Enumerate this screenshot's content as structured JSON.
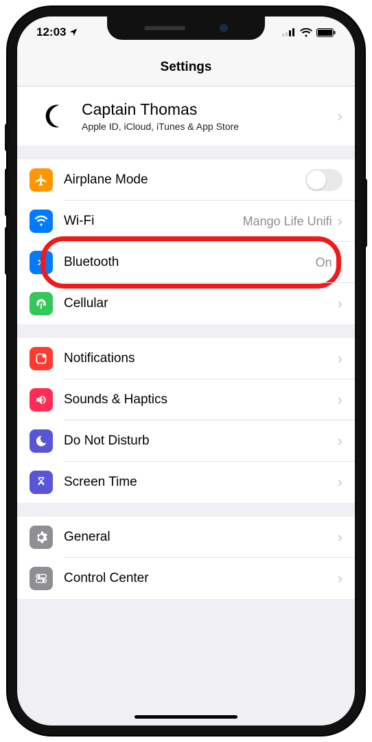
{
  "statusbar": {
    "time": "12:03"
  },
  "header": {
    "title": "Settings"
  },
  "profile": {
    "name": "Captain Thomas",
    "subtitle": "Apple ID, iCloud, iTunes & App Store"
  },
  "group1": {
    "airplane": {
      "label": "Airplane Mode"
    },
    "wifi": {
      "label": "Wi-Fi",
      "detail": "Mango Life Unifi"
    },
    "bluetooth": {
      "label": "Bluetooth",
      "detail": "On"
    },
    "cellular": {
      "label": "Cellular"
    }
  },
  "group2": {
    "notifications": {
      "label": "Notifications"
    },
    "sounds": {
      "label": "Sounds & Haptics"
    },
    "dnd": {
      "label": "Do Not Disturb"
    },
    "screentime": {
      "label": "Screen Time"
    }
  },
  "group3": {
    "general": {
      "label": "General"
    },
    "controlcenter": {
      "label": "Control Center"
    }
  }
}
